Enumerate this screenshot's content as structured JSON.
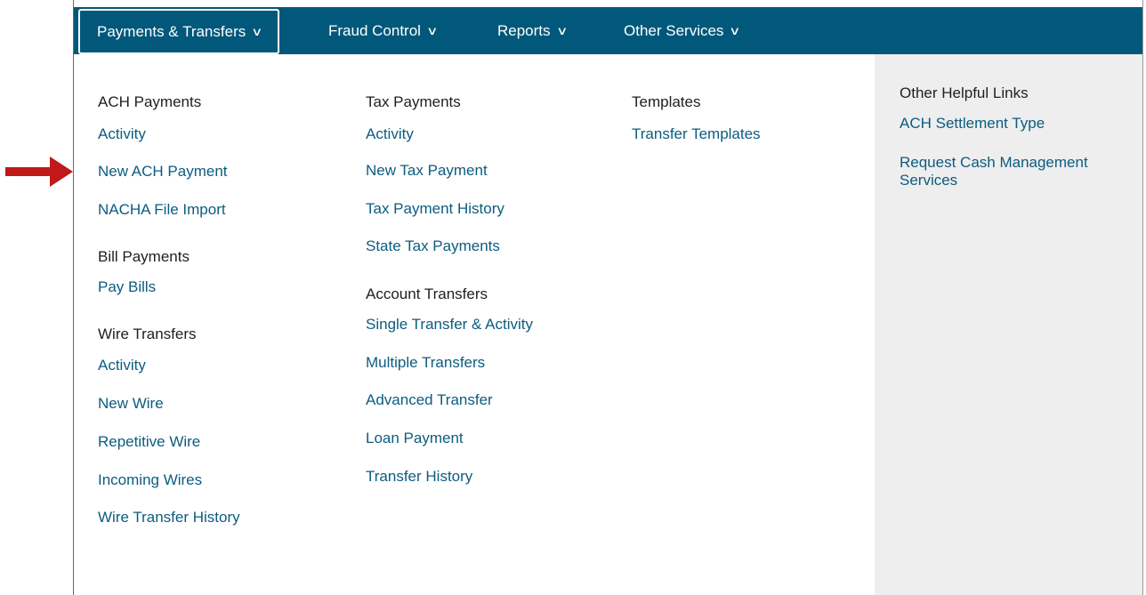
{
  "nav": {
    "items": [
      {
        "label": "Payments & Transfers",
        "chevron": "∨"
      },
      {
        "label": "Fraud Control",
        "chevron": "∨"
      },
      {
        "label": "Reports",
        "chevron": "∨"
      },
      {
        "label": "Other Services",
        "chevron": "∨"
      }
    ],
    "background": "#02587a"
  },
  "columns": {
    "col1": {
      "ach": {
        "heading": "ACH Payments",
        "links": [
          "Activity",
          "New ACH Payment",
          "NACHA File Import"
        ]
      },
      "bill": {
        "heading": "Bill Payments",
        "links": [
          "Pay Bills"
        ]
      },
      "wire": {
        "heading": "Wire Transfers",
        "links": [
          "Activity",
          "New Wire",
          "Repetitive Wire",
          "Incoming Wires",
          "Wire Transfer History"
        ]
      }
    },
    "col2": {
      "tax": {
        "heading": "Tax Payments",
        "links": [
          "Activity",
          "New Tax Payment",
          "Tax Payment History",
          "State Tax Payments"
        ]
      },
      "account": {
        "heading": "Account Transfers",
        "links": [
          "Single Transfer & Activity",
          "Multiple Transfers",
          "Advanced Transfer",
          "Loan Payment",
          "Transfer History"
        ]
      }
    },
    "col3": {
      "templates": {
        "heading": "Templates",
        "links": [
          "Transfer Templates"
        ]
      }
    },
    "col4": {
      "helpful": {
        "heading": "Other Helpful Links",
        "links": [
          "ACH Settlement Type",
          "Request Cash Management Services"
        ]
      }
    }
  },
  "annotation": {
    "arrow_icon": "right-arrow-icon",
    "arrow_color": "#c0191a"
  },
  "colors": {
    "link": "#0c5c80",
    "heading": "#1f1f1f",
    "side_panel": "#eeeeee"
  }
}
